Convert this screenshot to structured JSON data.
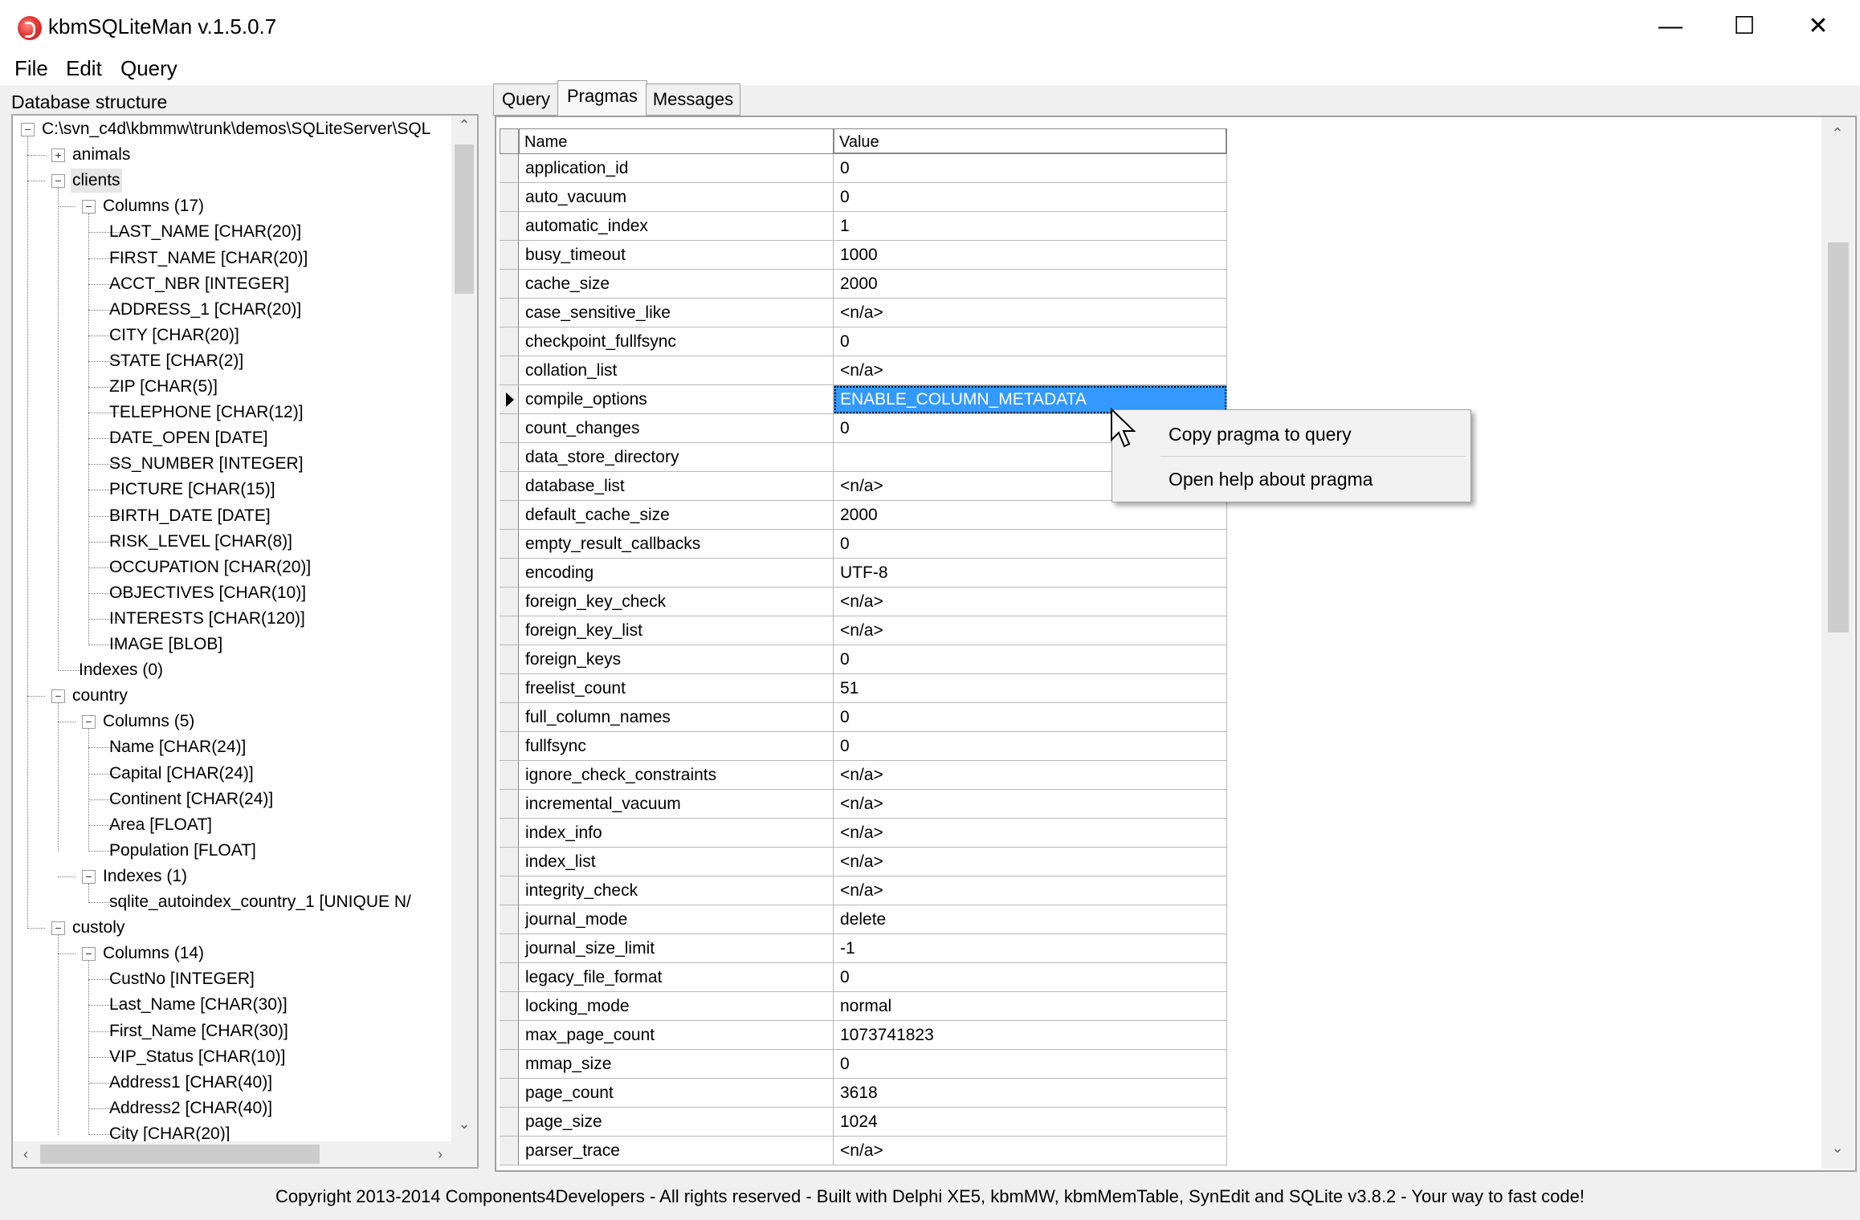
{
  "window": {
    "title": "kbmSQLiteMan v.1.5.0.7",
    "minimize": "—",
    "maximize": "☐",
    "close": "✕"
  },
  "menubar": {
    "file": "File",
    "edit": "Edit",
    "query": "Query"
  },
  "left_panel": {
    "label": "Database structure",
    "tree": [
      {
        "depth": 0,
        "label": "C:\\svn_c4d\\kbmmw\\trunk\\demos\\SQLiteServer\\SQL",
        "expander": "minus"
      },
      {
        "depth": 1,
        "label": "animals",
        "expander": "plus"
      },
      {
        "depth": 1,
        "label": "clients",
        "expander": "minus",
        "selected": true
      },
      {
        "depth": 2,
        "label": "Columns (17)",
        "expander": "minus"
      },
      {
        "depth": 3,
        "label": "LAST_NAME [CHAR(20)]"
      },
      {
        "depth": 3,
        "label": "FIRST_NAME [CHAR(20)]"
      },
      {
        "depth": 3,
        "label": "ACCT_NBR [INTEGER]"
      },
      {
        "depth": 3,
        "label": "ADDRESS_1 [CHAR(20)]"
      },
      {
        "depth": 3,
        "label": "CITY [CHAR(20)]"
      },
      {
        "depth": 3,
        "label": "STATE [CHAR(2)]"
      },
      {
        "depth": 3,
        "label": "ZIP [CHAR(5)]"
      },
      {
        "depth": 3,
        "label": "TELEPHONE [CHAR(12)]"
      },
      {
        "depth": 3,
        "label": "DATE_OPEN [DATE]"
      },
      {
        "depth": 3,
        "label": "SS_NUMBER [INTEGER]"
      },
      {
        "depth": 3,
        "label": "PICTURE [CHAR(15)]"
      },
      {
        "depth": 3,
        "label": "BIRTH_DATE [DATE]"
      },
      {
        "depth": 3,
        "label": "RISK_LEVEL [CHAR(8)]"
      },
      {
        "depth": 3,
        "label": "OCCUPATION [CHAR(20)]"
      },
      {
        "depth": 3,
        "label": "OBJECTIVES [CHAR(10)]"
      },
      {
        "depth": 3,
        "label": "INTERESTS [CHAR(120)]"
      },
      {
        "depth": 3,
        "label": "IMAGE [BLOB]"
      },
      {
        "depth": 2,
        "label": "Indexes (0)"
      },
      {
        "depth": 1,
        "label": "country",
        "expander": "minus"
      },
      {
        "depth": 2,
        "label": "Columns (5)",
        "expander": "minus"
      },
      {
        "depth": 3,
        "label": "Name [CHAR(24)]"
      },
      {
        "depth": 3,
        "label": "Capital [CHAR(24)]"
      },
      {
        "depth": 3,
        "label": "Continent [CHAR(24)]"
      },
      {
        "depth": 3,
        "label": "Area [FLOAT]"
      },
      {
        "depth": 3,
        "label": "Population [FLOAT]"
      },
      {
        "depth": 2,
        "label": "Indexes (1)",
        "expander": "minus"
      },
      {
        "depth": 3,
        "label": "sqlite_autoindex_country_1 [UNIQUE N/"
      },
      {
        "depth": 1,
        "label": "custoly",
        "expander": "minus"
      },
      {
        "depth": 2,
        "label": "Columns (14)",
        "expander": "minus"
      },
      {
        "depth": 3,
        "label": "CustNo [INTEGER]"
      },
      {
        "depth": 3,
        "label": "Last_Name [CHAR(30)]"
      },
      {
        "depth": 3,
        "label": "First_Name [CHAR(30)]"
      },
      {
        "depth": 3,
        "label": "VIP_Status [CHAR(10)]"
      },
      {
        "depth": 3,
        "label": "Address1 [CHAR(40)]"
      },
      {
        "depth": 3,
        "label": "Address2 [CHAR(40)]"
      },
      {
        "depth": 3,
        "label": "City [CHAR(20)]"
      }
    ]
  },
  "tabs": [
    {
      "label": "Query",
      "active": false
    },
    {
      "label": "Pragmas",
      "active": true
    },
    {
      "label": "Messages",
      "active": false
    }
  ],
  "grid": {
    "columns": [
      "Name",
      "Value"
    ],
    "rows": [
      [
        "application_id",
        "0"
      ],
      [
        "auto_vacuum",
        "0"
      ],
      [
        "automatic_index",
        "1"
      ],
      [
        "busy_timeout",
        "1000"
      ],
      [
        "cache_size",
        "2000"
      ],
      [
        "case_sensitive_like",
        "<n/a>"
      ],
      [
        "checkpoint_fullfsync",
        "0"
      ],
      [
        "collation_list",
        "<n/a>"
      ],
      [
        "compile_options",
        "ENABLE_COLUMN_METADATA"
      ],
      [
        "count_changes",
        "0"
      ],
      [
        "data_store_directory",
        ""
      ],
      [
        "database_list",
        "<n/a>"
      ],
      [
        "default_cache_size",
        "2000"
      ],
      [
        "empty_result_callbacks",
        "0"
      ],
      [
        "encoding",
        "UTF-8"
      ],
      [
        "foreign_key_check",
        "<n/a>"
      ],
      [
        "foreign_key_list",
        "<n/a>"
      ],
      [
        "foreign_keys",
        "0"
      ],
      [
        "freelist_count",
        "51"
      ],
      [
        "full_column_names",
        "0"
      ],
      [
        "fullfsync",
        "0"
      ],
      [
        "ignore_check_constraints",
        "<n/a>"
      ],
      [
        "incremental_vacuum",
        "<n/a>"
      ],
      [
        "index_info",
        "<n/a>"
      ],
      [
        "index_list",
        "<n/a>"
      ],
      [
        "integrity_check",
        "<n/a>"
      ],
      [
        "journal_mode",
        "delete"
      ],
      [
        "journal_size_limit",
        "-1"
      ],
      [
        "legacy_file_format",
        "0"
      ],
      [
        "locking_mode",
        "normal"
      ],
      [
        "max_page_count",
        "1073741823"
      ],
      [
        "mmap_size",
        "0"
      ],
      [
        "page_count",
        "3618"
      ],
      [
        "page_size",
        "1024"
      ],
      [
        "parser_trace",
        "<n/a>"
      ]
    ],
    "current_row": 8
  },
  "context_menu": {
    "items": [
      "Copy pragma to query",
      "Open help about pragma"
    ]
  },
  "status_bar": "Copyright 2013-2014 Components4Developers - All rights reserved - Built with Delphi XE5, kbmMW, kbmMemTable, SynEdit and SQLite v3.8.2 - Your way to fast code!"
}
